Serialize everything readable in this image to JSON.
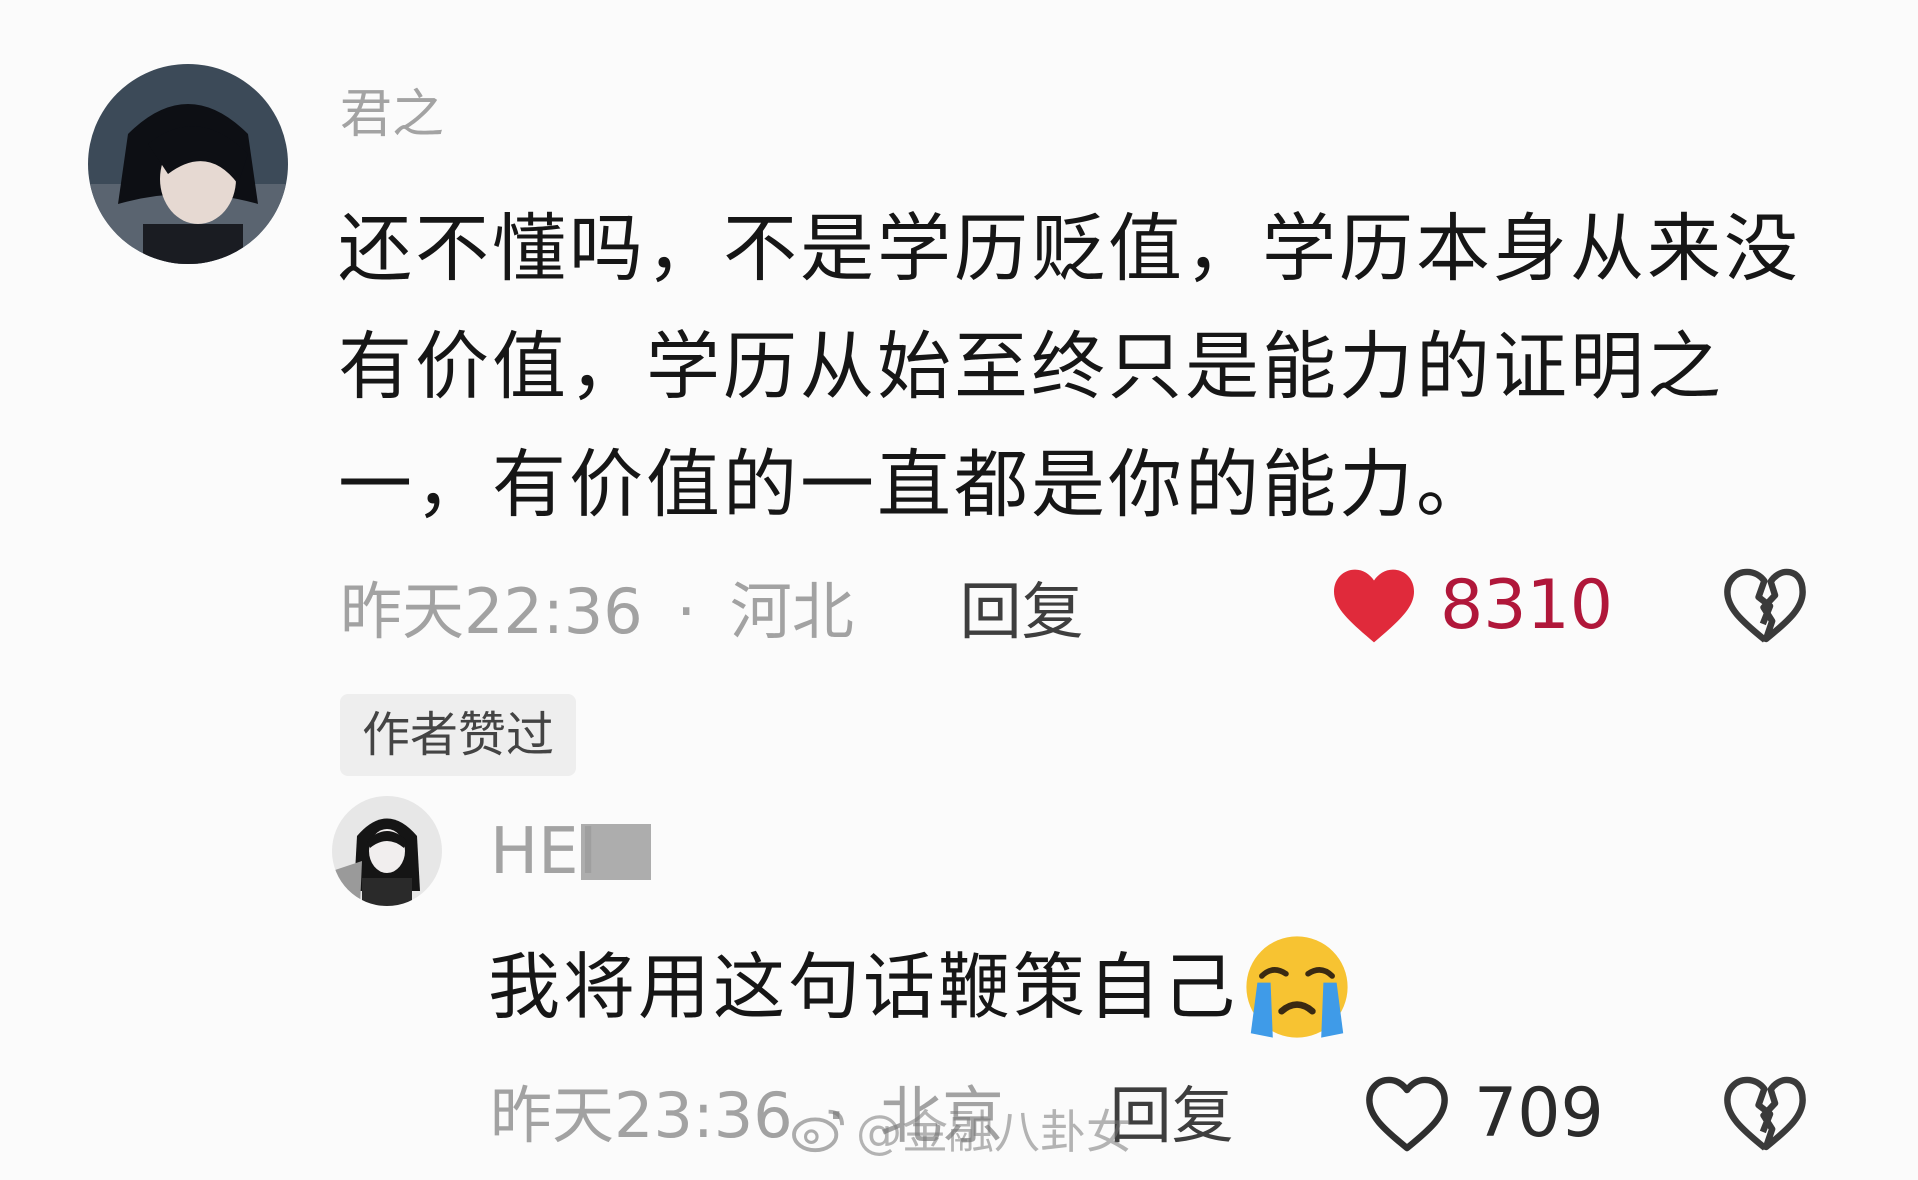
{
  "comments": [
    {
      "username": "君之",
      "text": "还不懂吗，不是学历贬值，学历本身从来没有价值，学历从始至终只是能力的证明之一，有价值的一直都是你的能力。",
      "time": "昨天22:36",
      "separator": "·",
      "location": "河北",
      "reply_label": "回复",
      "like_count": "8310",
      "liked": true,
      "badge": "作者赞过"
    },
    {
      "username": "HEI",
      "text": "我将用这句话鞭策自己",
      "emoji": "loudly-crying-face",
      "time": "昨天23:36",
      "separator": "·",
      "location": "北京",
      "reply_label": "回复",
      "like_count": "709",
      "liked": false
    }
  ],
  "watermark": "@金融八卦女",
  "colors": {
    "like_red": "#e02a3b",
    "like_count_red": "#b0173a",
    "meta_gray": "#a2a2a2",
    "text": "#161616"
  }
}
